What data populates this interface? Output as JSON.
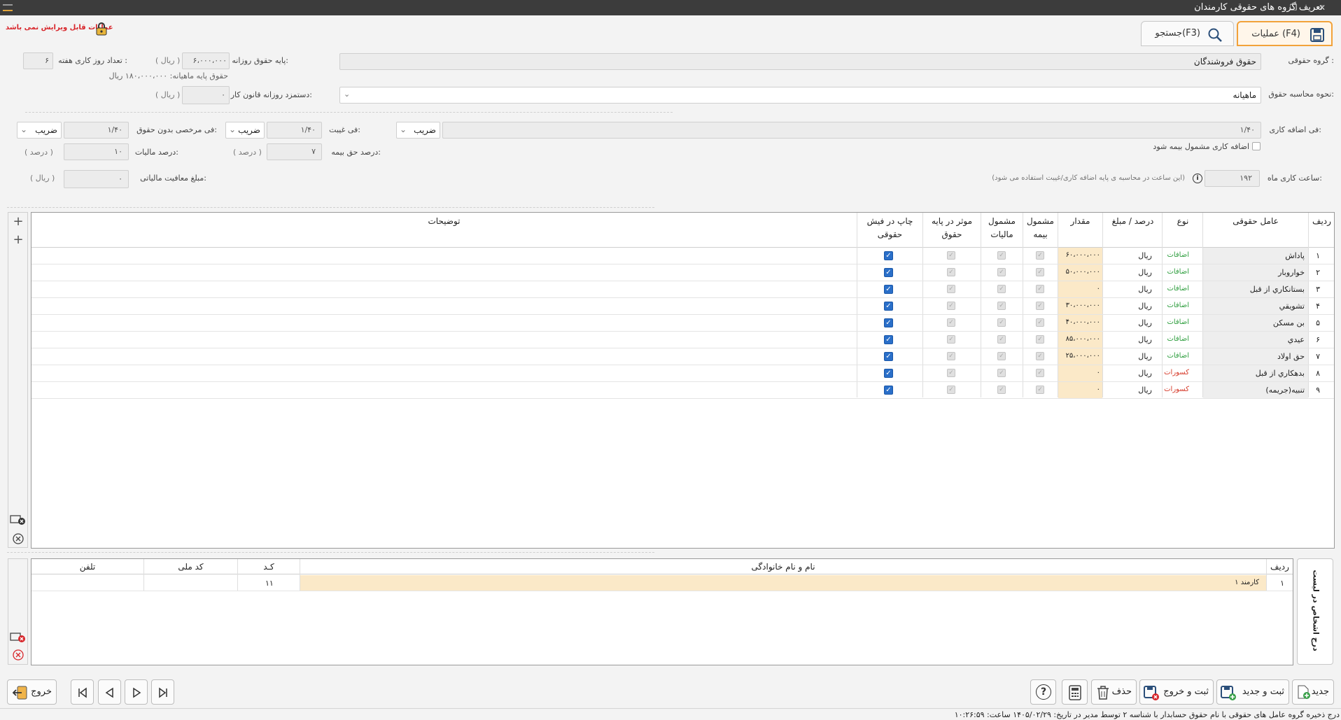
{
  "window": {
    "title": "تعریف گروه های حقوقی کارمندان",
    "restore_glyph": "❐",
    "close_glyph": "✕"
  },
  "lock_notice": "عملیات قابل ویرایش نمی باشد",
  "tabs": [
    {
      "label": "عملیات (F4)",
      "icon": "floppy-disk-icon"
    },
    {
      "label": "جستجو(F3)",
      "icon": "search-icon"
    }
  ],
  "form": {
    "group_label": "گروه حقوقی :",
    "group_value": "حقوق فروشندگان",
    "calc_label": "نحوه محاسبه حقوق:",
    "calc_value": "ماهیانه",
    "daily_base_label": "پایه حقوق روزانه:",
    "daily_base_value": "۶،۰۰۰،۰۰۰",
    "daily_base_unit": "( ریال )",
    "workdays_label": "تعداد روز کاری هفته :",
    "workdays_value": "۶",
    "monthly_base_text": "حقوق پایه ماهیانه: ۱۸۰،۰۰۰،۰۰۰ ریال",
    "legal_wage_label": "دستمزد روزانه قانون کار:",
    "legal_wage_value": "۰",
    "legal_wage_unit": "( ریال )",
    "overtime_label": "فی اضافه کاری:",
    "overtime_value": "۱/۴۰",
    "absence_label": "فی غیبت:",
    "absence_value": "۱/۴۰",
    "absence_mode": "ضریب",
    "unpaid_leave_label": "فی مرخصی بدون حقوق:",
    "unpaid_leave_value": "۱/۴۰",
    "unpaid_leave_mode": "ضریب",
    "overtime_mode": "ضریب",
    "overtime_insurance_label": "اضافه کاری مشمول بیمه شود",
    "insurance_pct_label": "درصد حق بیمه:",
    "insurance_pct_value": "۷",
    "insurance_pct_unit": "( درصد )",
    "tax_pct_label": "درصد مالیات:",
    "tax_pct_value": "۱۰",
    "tax_pct_unit": "( درصد )",
    "monthly_hours_label": "ساعت کاری ماه:",
    "monthly_hours_value": "۱۹۲",
    "monthly_hours_note": "(این ساعت در محاسبه ی پایه اضافه کاری/غیبت استفاده می شود)",
    "tax_exempt_label": "مبلغ معافیت مالیاتی:",
    "tax_exempt_value": "۰",
    "tax_exempt_unit": "( ریال )"
  },
  "grid": {
    "headers": {
      "row": "ردیف",
      "factor": "عامل حقوقی",
      "type": "نوع",
      "pct_amount": "درصد / مبلغ",
      "amount": "مقدار",
      "insurance_1": "مشمول",
      "insurance_2": "بیمه",
      "tax_1": "مشمول",
      "tax_2": "مالیات",
      "base_1": "موثر در پایه",
      "base_2": "حقوق",
      "print_1": "چاپ در فیش",
      "print_2": "حقوقی",
      "desc": "توضیحات"
    },
    "rows": [
      {
        "n": "۱",
        "name": "پاداش",
        "type": "اضافات",
        "unit": "ریال",
        "amount": "۶۰،۰۰۰،۰۰۰"
      },
      {
        "n": "۲",
        "name": "خواروبار",
        "type": "اضافات",
        "unit": "ریال",
        "amount": "۵۰،۰۰۰،۰۰۰"
      },
      {
        "n": "۳",
        "name": "بستانكاري از قبل",
        "type": "اضافات",
        "unit": "ریال",
        "amount": "۰"
      },
      {
        "n": "۴",
        "name": "تشويقي",
        "type": "اضافات",
        "unit": "ریال",
        "amount": "۳۰،۰۰۰،۰۰۰"
      },
      {
        "n": "۵",
        "name": "بن مسكن",
        "type": "اضافات",
        "unit": "ریال",
        "amount": "۴۰،۰۰۰،۰۰۰"
      },
      {
        "n": "۶",
        "name": "عيدي",
        "type": "اضافات",
        "unit": "ریال",
        "amount": "۸۵،۰۰۰،۰۰۰"
      },
      {
        "n": "۷",
        "name": "حق اولاد",
        "type": "اضافات",
        "unit": "ریال",
        "amount": "۲۵،۰۰۰،۰۰۰"
      },
      {
        "n": "۸",
        "name": "بدهكاري از قبل",
        "type": "کسورات",
        "unit": "ریال",
        "amount": "۰"
      },
      {
        "n": "۹",
        "name": "تنبيه(جريمه)",
        "type": "کسورات",
        "unit": "ریال",
        "amount": "۰"
      }
    ]
  },
  "staff": {
    "insert_button": "درج اشخاص در لیست",
    "headers": {
      "row": "ردیف",
      "name": "نام و نام خانوادگی",
      "code": "کـد",
      "national": "کد ملی",
      "phone": "تلفن"
    },
    "rows": [
      {
        "n": "۱",
        "name": "کارمند ۱",
        "code": "۱۱",
        "national": "",
        "phone": ""
      }
    ]
  },
  "toolbar": {
    "new": "جدید",
    "save_new": "ثبت و جدید",
    "save_exit": "ثبت و خروج",
    "delete": "حذف",
    "exit": "خروج"
  },
  "status": "درج ذخیره گروه عامل های حقوقی با نام حقوق حسابدار با شناسه ۲ توسط مدیر در تاریخ: ۱۴۰۵/۰۲/۲۹ ساعت: ۱۰:۲۶:۵۹",
  "colors": {
    "accent": "#f2a23a",
    "additions": "#2e9e3e",
    "deductions": "#d63a2a",
    "lock": "#d8262b"
  }
}
